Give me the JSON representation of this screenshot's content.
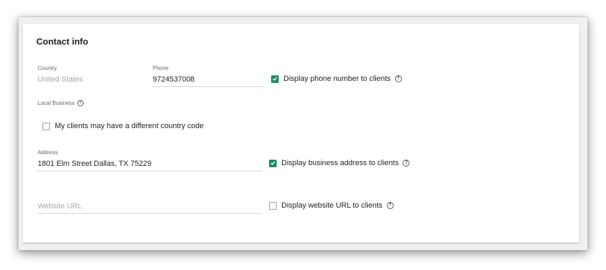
{
  "section": {
    "title": "Contact info"
  },
  "country": {
    "label": "Country",
    "value": "United States"
  },
  "phone": {
    "label": "Phone",
    "value": "9724537008",
    "display_label": "Display phone number to clients",
    "display_checked": true
  },
  "local_business": {
    "label": "Local Business",
    "checkbox_label": "My clients may have a different country code",
    "checked": false
  },
  "address": {
    "label": "Address",
    "value": "1801 Elm Street Dallas, TX 75229",
    "display_label": "Display business address to clients",
    "display_checked": true
  },
  "website": {
    "placeholder": "Website URL",
    "display_label": "Display website URL to clients",
    "display_checked": false
  },
  "icons": {
    "help": "question-circle-icon",
    "check": "checkmark-icon"
  },
  "colors": {
    "accent": "#1b8a6b"
  }
}
